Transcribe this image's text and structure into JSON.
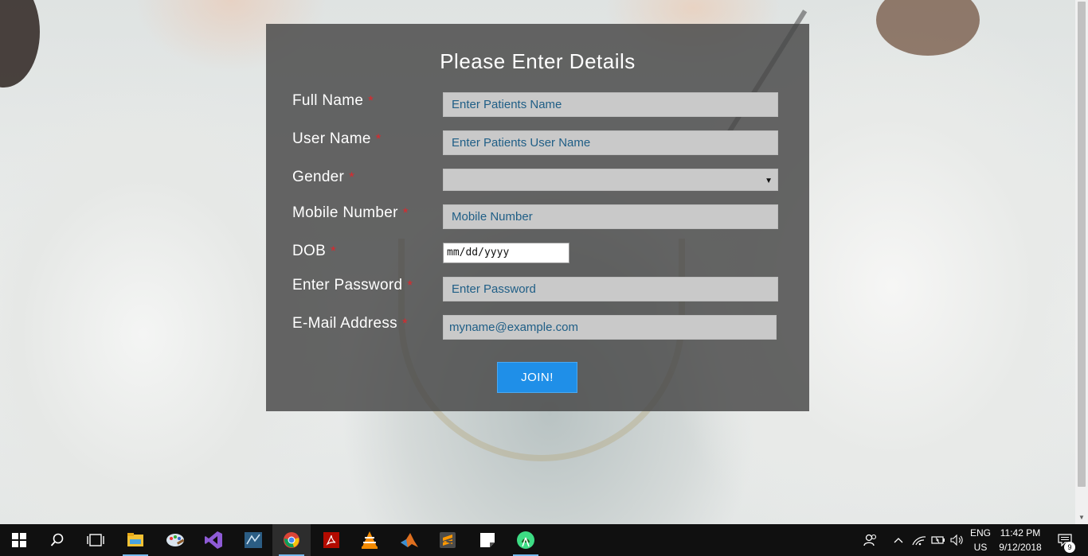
{
  "form": {
    "title": "Please Enter Details",
    "required_mark": "*",
    "full_name": {
      "label": "Full Name",
      "placeholder": "Enter Patients Name"
    },
    "user_name": {
      "label": "User Name",
      "placeholder": "Enter Patients User Name"
    },
    "gender": {
      "label": "Gender",
      "value": ""
    },
    "mobile": {
      "label": "Mobile Number",
      "placeholder": "Mobile Number"
    },
    "dob": {
      "label": "DOB",
      "placeholder": "mm/dd/yyyy"
    },
    "password": {
      "label": "Enter Password",
      "placeholder": "Enter Password"
    },
    "email": {
      "label": "E-Mail Address",
      "placeholder": "myname@example.com"
    },
    "submit_label": "JOIN!"
  },
  "taskbar": {
    "apps": [
      "start-icon",
      "search-icon",
      "task-view-icon",
      "file-explorer-icon",
      "paint-icon",
      "visual-studio-icon",
      "sql-server-icon",
      "chrome-icon",
      "acrobat-icon",
      "vlc-icon",
      "matlab-icon",
      "sublime-text-icon",
      "sticky-notes-icon",
      "android-studio-icon"
    ],
    "language_top": "ENG",
    "language_bottom": "US",
    "time": "11:42 PM",
    "date": "9/12/2018",
    "notification_count": "9"
  },
  "colors": {
    "panel": "#464646",
    "button": "#1f8fe8",
    "required": "#e0262b",
    "field": "#c9c9c9",
    "field_text": "#1f5e86"
  }
}
